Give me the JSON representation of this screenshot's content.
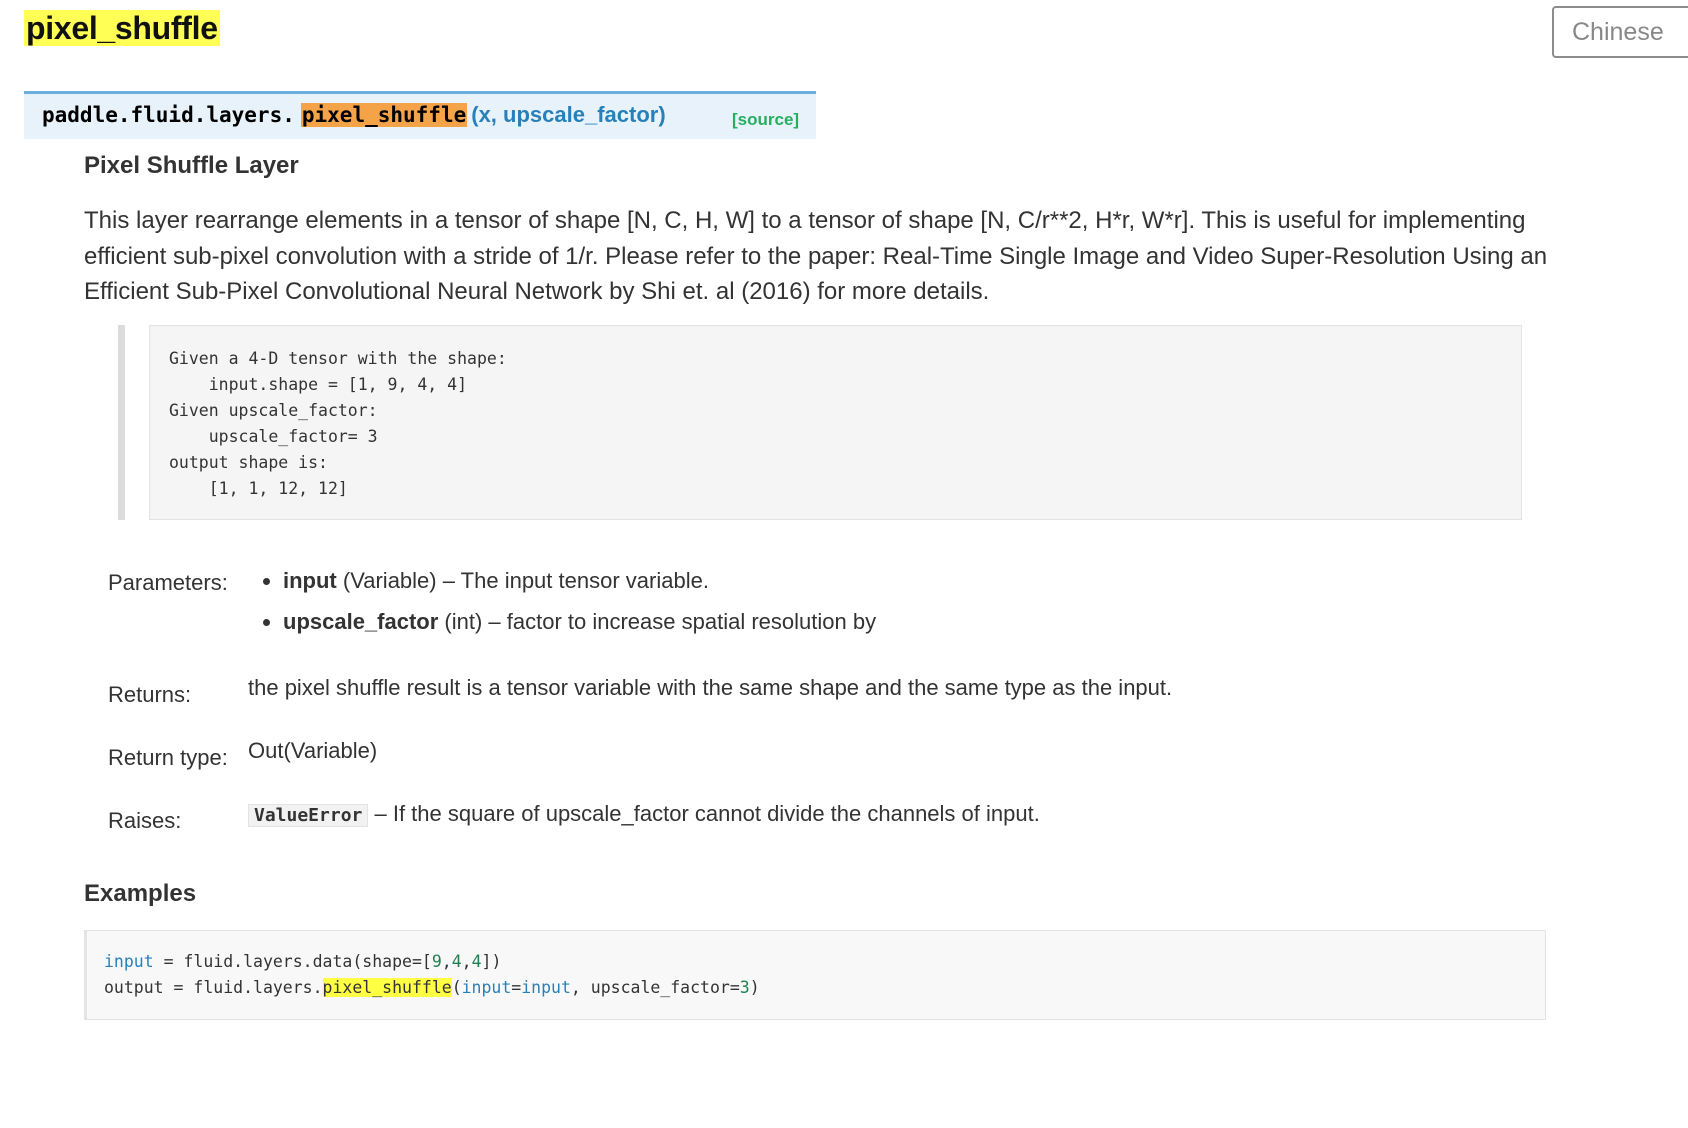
{
  "page": {
    "title": "pixel_shuffle",
    "lang_button": "Chinese"
  },
  "signature": {
    "prefix": "paddle.fluid.layers.",
    "name": "pixel_shuffle",
    "args": "(x, upscale_factor)",
    "source": "[source]"
  },
  "section": {
    "subtitle": "Pixel Shuffle Layer",
    "description": "This layer rearrange elements in a tensor of shape [N, C, H, W] to a tensor of shape [N, C/r**2, H*r, W*r]. This is useful for implementing efficient sub-pixel convolution with a stride of 1/r. Please refer to the paper: Real-Time Single Image and Video Super-Resolution Using an Efficient Sub-Pixel Convolutional Neural Network by Shi et. al (2016) for more details."
  },
  "shape_example": {
    "lines": [
      "Given a 4-D tensor with the shape:",
      "    input.shape = [1, 9, 4, 4]",
      "Given upscale_factor:",
      "    upscale_factor= 3",
      "output shape is:",
      "    [1, 1, 12, 12]"
    ]
  },
  "fields": {
    "parameters_label": "Parameters:",
    "params": [
      {
        "name": "input",
        "desc": " (Variable) – The input tensor variable."
      },
      {
        "name": "upscale_factor",
        "desc": " (int) – factor to increase spatial resolution by"
      }
    ],
    "returns_label": "Returns:",
    "returns_text": "the pixel shuffle result is a tensor variable with the same shape and the same type as the input.",
    "return_type_label": "Return type:",
    "return_type_text": "Out(Variable)",
    "raises_label": "Raises:",
    "raises_code": "ValueError",
    "raises_text": " – If the square of upscale_factor cannot divide the channels of input."
  },
  "examples": {
    "heading": "Examples",
    "line1": {
      "kw": "input",
      "a": " = fluid.layers.data(shape=[",
      "n1": "9",
      "c1": ",",
      "n2": "4",
      "c2": ",",
      "n3": "4",
      "end": "])"
    },
    "line2": {
      "a": "output = fluid.layers.",
      "fn": "pixel_shuffle",
      "p1": "(",
      "kw1": "input",
      "eq": "=",
      "kw2": "input",
      "mid": ", upscale_factor=",
      "n": "3",
      "end": ")"
    }
  },
  "colors": {
    "title_highlight": "#ffff55",
    "signature_bg": "#e7f2fa",
    "signature_border": "#6ab0de",
    "name_highlight": "#f4a349",
    "args_blue": "#2980b9",
    "source_green": "#27ae60"
  }
}
